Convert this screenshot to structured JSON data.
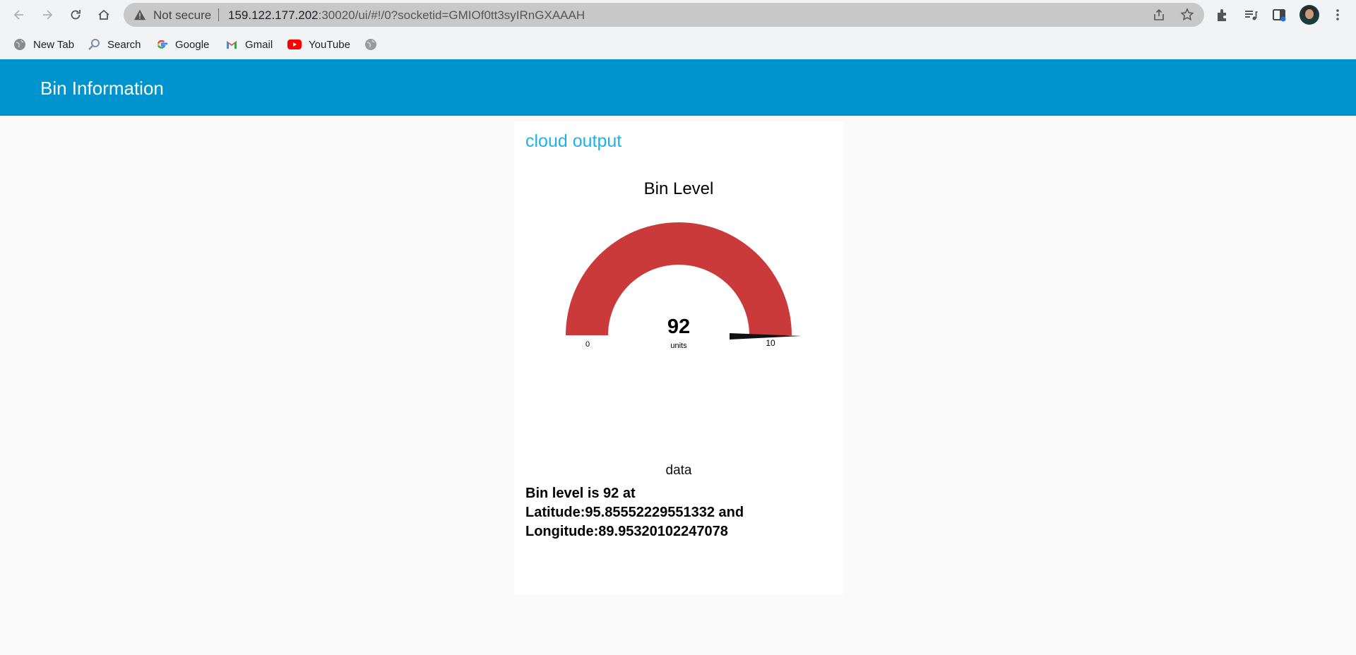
{
  "browser": {
    "security_label": "Not secure",
    "url_host": "159.122.177.202",
    "url_rest": ":30020/ui/#!/0?socketid=GMIOf0tt3syIRnGXAAAH"
  },
  "bookmarks": [
    {
      "label": "New Tab",
      "icon": "globe-icon"
    },
    {
      "label": "Search",
      "icon": "search-icon"
    },
    {
      "label": "Google",
      "icon": "google-icon"
    },
    {
      "label": "Gmail",
      "icon": "gmail-icon"
    },
    {
      "label": "YouTube",
      "icon": "youtube-icon"
    }
  ],
  "header": {
    "title": "Bin Information",
    "color": "#0094ce"
  },
  "card": {
    "title": "cloud output",
    "title_color": "#1bb3e8"
  },
  "gauge": {
    "title": "Bin Level",
    "value": "92",
    "units": "units",
    "min": "0",
    "max": "10",
    "fill_color": "#cb3a3a"
  },
  "data": {
    "label": "data",
    "line1": "Bin level is 92 at",
    "line2": "Latitude:95.85552229551332 and",
    "line3": "Longitude:89.95320102247078"
  }
}
